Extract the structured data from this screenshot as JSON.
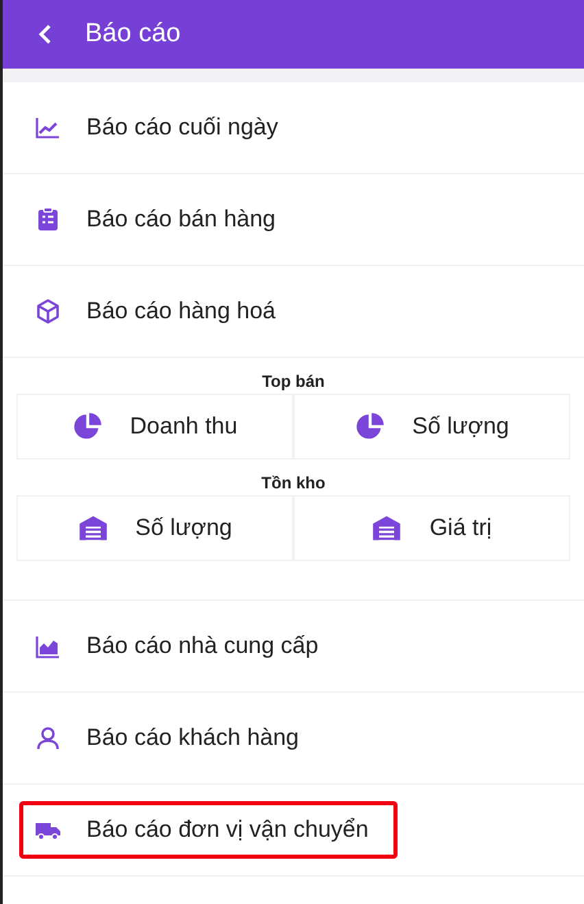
{
  "header": {
    "title": "Báo cáo"
  },
  "sections": [
    {
      "kind": "row",
      "label": "Báo cáo cuối ngày",
      "highlighted": false
    },
    {
      "kind": "row",
      "label": "Báo cáo bán hàng",
      "highlighted": false
    },
    {
      "kind": "row",
      "label": "Báo cáo hàng hoá",
      "highlighted": false
    },
    {
      "kind": "groups",
      "groups": [
        {
          "title": "Top bán",
          "cells": [
            "Doanh thu",
            "Số lượng"
          ]
        },
        {
          "title": "Tồn kho",
          "cells": [
            "Số lượng",
            "Giá trị"
          ]
        }
      ]
    },
    {
      "kind": "row",
      "label": "Báo cáo nhà cung cấp",
      "highlighted": false
    },
    {
      "kind": "row",
      "label": "Báo cáo khách hàng",
      "highlighted": false
    },
    {
      "kind": "row",
      "label": "Báo cáo đơn vị vận chuyển",
      "highlighted": true
    }
  ]
}
